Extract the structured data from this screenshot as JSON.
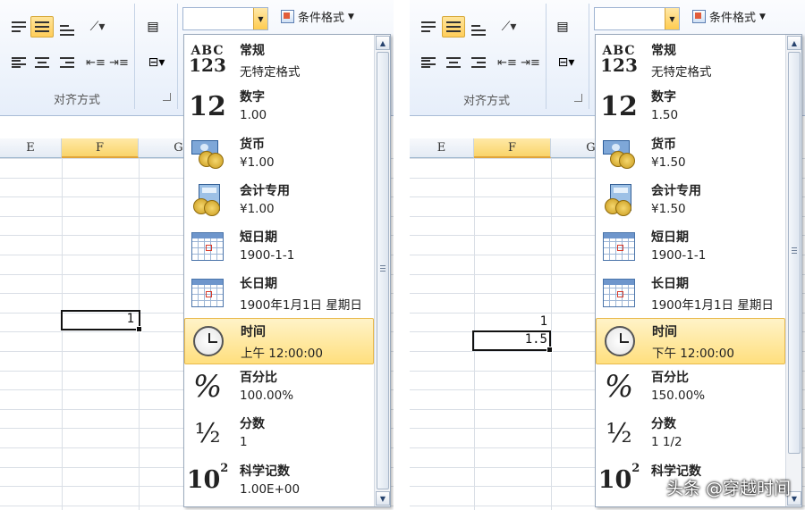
{
  "ribbon": {
    "alignment_group_label": "对齐方式",
    "number_format_value": "",
    "conditional_format_label": "条件格式"
  },
  "columns": [
    "E",
    "F",
    "G"
  ],
  "left": {
    "cells": [
      {
        "value": "1"
      }
    ],
    "formats": [
      {
        "icon": "abc-123-icon",
        "name": "常规",
        "sample": "无特定格式"
      },
      {
        "icon": "number-12-icon",
        "name": "数字",
        "sample": "1.00"
      },
      {
        "icon": "currency-icon",
        "name": "货币",
        "sample": "¥1.00"
      },
      {
        "icon": "accounting-icon",
        "name": "会计专用",
        "sample": " ¥1.00"
      },
      {
        "icon": "calendar-icon",
        "name": "短日期",
        "sample": "1900-1-1"
      },
      {
        "icon": "calendar-icon",
        "name": "长日期",
        "sample": "1900年1月1日 星期日"
      },
      {
        "icon": "clock-icon",
        "name": "时间",
        "sample": "上午 12:00:00"
      },
      {
        "icon": "percent-icon",
        "name": "百分比",
        "sample": "100.00%"
      },
      {
        "icon": "fraction-icon",
        "name": "分数",
        "sample": "1"
      },
      {
        "icon": "scientific-icon",
        "name": "科学记数",
        "sample": "1.00E+00"
      }
    ]
  },
  "right": {
    "cells": [
      {
        "value": "1"
      },
      {
        "value": "1.5"
      }
    ],
    "formats": [
      {
        "icon": "abc-123-icon",
        "name": "常规",
        "sample": "无特定格式"
      },
      {
        "icon": "number-12-icon",
        "name": "数字",
        "sample": "1.50"
      },
      {
        "icon": "currency-icon",
        "name": "货币",
        "sample": "¥1.50"
      },
      {
        "icon": "accounting-icon",
        "name": "会计专用",
        "sample": " ¥1.50"
      },
      {
        "icon": "calendar-icon",
        "name": "短日期",
        "sample": "1900-1-1"
      },
      {
        "icon": "calendar-icon",
        "name": "长日期",
        "sample": "1900年1月1日 星期日"
      },
      {
        "icon": "clock-icon",
        "name": "时间",
        "sample": "下午 12:00:00"
      },
      {
        "icon": "percent-icon",
        "name": "百分比",
        "sample": "150.00%"
      },
      {
        "icon": "fraction-icon",
        "name": "分数",
        "sample": "1 1/2"
      },
      {
        "icon": "scientific-icon",
        "name": "科学记数",
        "sample": ""
      }
    ]
  },
  "icon_text": {
    "abc_top": "ABC",
    "abc_bottom": "123",
    "num": "12",
    "pct": "%",
    "frac": "½",
    "sci_base": "10",
    "sci_exp": "2"
  },
  "selected_format": "时间",
  "watermark": "头条 @穿越时间",
  "colors": {
    "selection": "#ffdf7e",
    "header_selected": "#f9d46a",
    "ribbon_bg": "#e6eefa"
  }
}
